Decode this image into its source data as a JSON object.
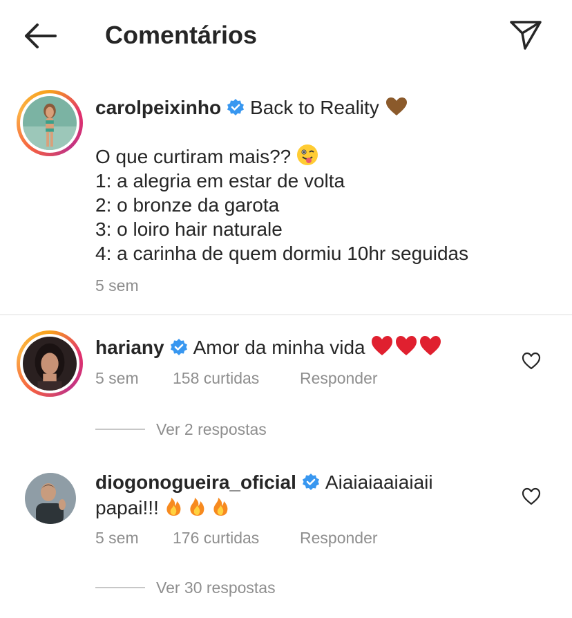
{
  "header": {
    "title": "Comentários",
    "back_icon": "arrow-left-icon",
    "send_icon": "paper-plane-icon"
  },
  "caption": {
    "username": "carolpeixinho",
    "title_text": "Back to Reality",
    "line1": "O que curtiram mais??",
    "line2": "1: a alegria em estar de volta",
    "line3": "2: o bronze da garota",
    "line4": "3: o loiro hair naturale",
    "line5": "4: a carinha de quem dormiu 10hr seguidas",
    "time": "5 sem"
  },
  "comments": [
    {
      "username": "hariany",
      "text": "Amor da minha vida",
      "time": "5 sem",
      "likes": "158 curtidas",
      "reply": "Responder",
      "view_replies": "Ver 2 respostas"
    },
    {
      "username": "diogonogueira_oficial",
      "text_line1": "Aiaiaiaaiaiaii",
      "text_line2": "papai!!!",
      "time": "5 sem",
      "likes": "176 curtidas",
      "reply": "Responder",
      "view_replies": "Ver 30 respostas"
    }
  ],
  "colors": {
    "verified": "#3897f0",
    "heart": "#e0202f",
    "meta": "#8e8e8e",
    "text": "#262626"
  }
}
